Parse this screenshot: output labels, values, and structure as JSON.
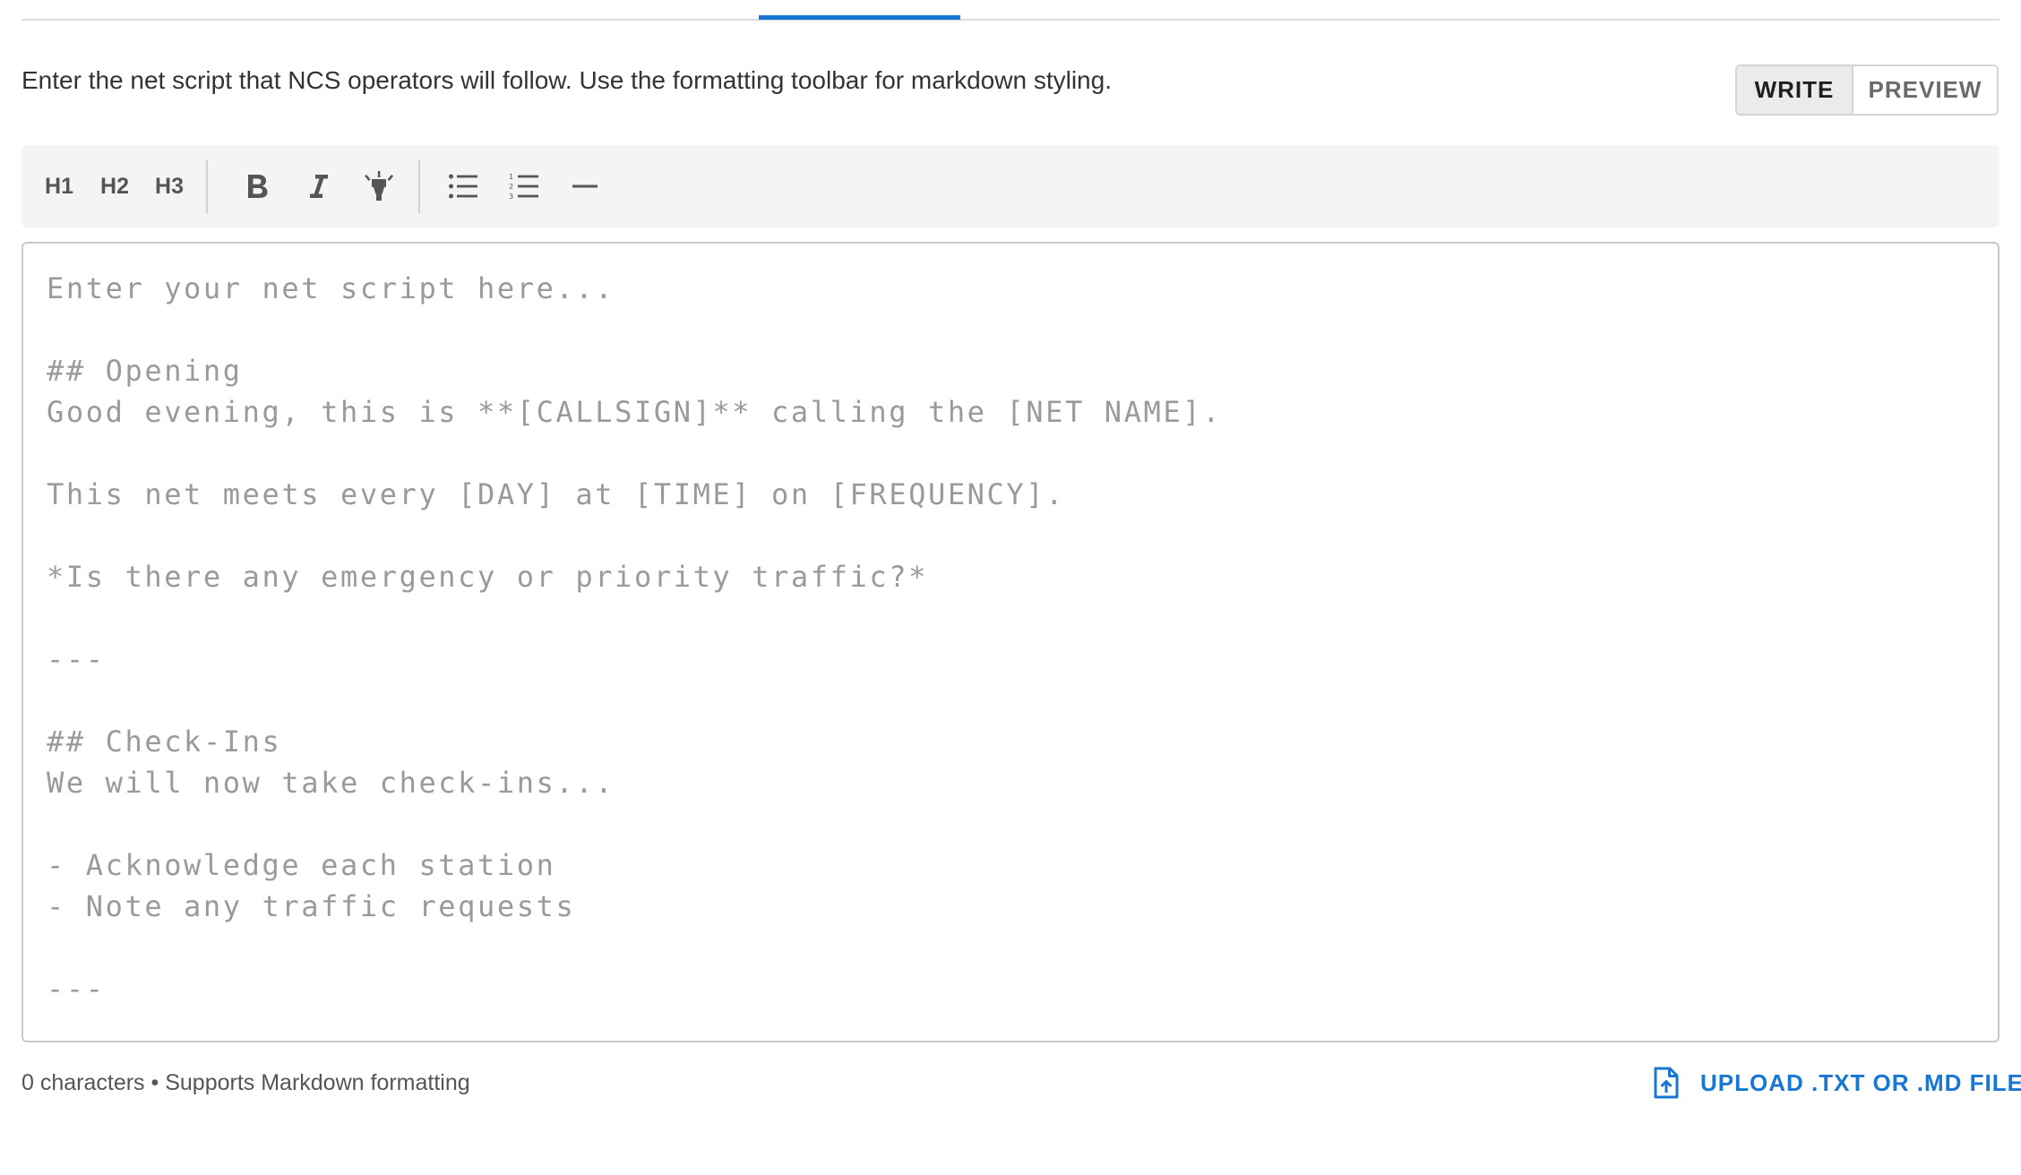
{
  "instructions": "Enter the net script that NCS operators will follow. Use the formatting toolbar for markdown styling.",
  "mode_toggle": {
    "write_label": "WRITE",
    "preview_label": "PREVIEW",
    "selected": "WRITE"
  },
  "toolbar": {
    "h1_label": "H1",
    "h2_label": "H2",
    "h3_label": "H3",
    "icons": [
      "bold-icon",
      "italic-icon",
      "highlight-icon",
      "bullet-list-icon",
      "numbered-list-icon",
      "horizontal-rule-icon"
    ]
  },
  "editor": {
    "value": "",
    "placeholder": "Enter your net script here...\n\n## Opening\nGood evening, this is **[CALLSIGN]** calling the [NET NAME].\n\nThis net meets every [DAY] at [TIME] on [FREQUENCY].\n\n*Is there any emergency or priority traffic?*\n\n---\n\n## Check-Ins\nWe will now take check-ins...\n\n- Acknowledge each station\n- Note any traffic requests\n\n---"
  },
  "footer": {
    "info": "0 characters • Supports Markdown formatting",
    "upload_label": "UPLOAD .TXT OR .MD FILE"
  },
  "colors": {
    "accent": "#1976d2",
    "toolbar_bg": "#f4f4f4",
    "placeholder_text": "#9a9a9a"
  }
}
